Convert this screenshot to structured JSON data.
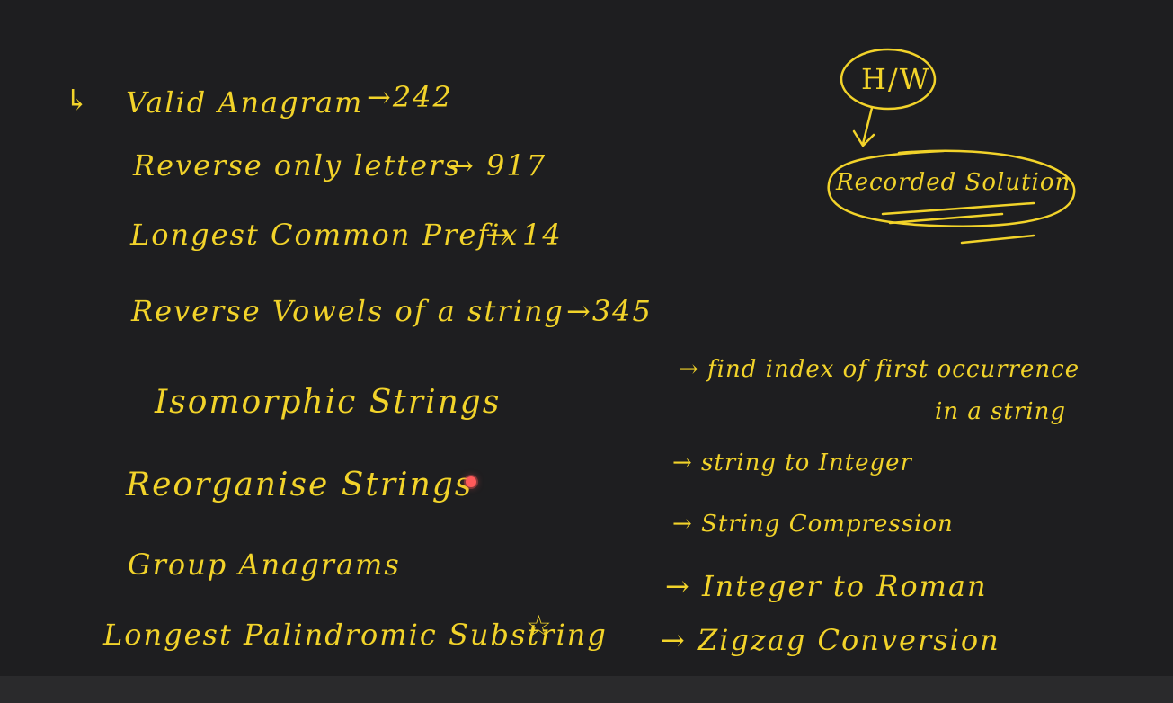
{
  "ink_color": "#f2d32a",
  "background": "#1e1e20",
  "left_list": {
    "items": [
      {
        "marker": "↳",
        "text": "Valid Anagram",
        "suffix": "→242"
      },
      {
        "text": "Reverse only letters",
        "suffix": "→ 917"
      },
      {
        "text": "Longest Common Prefix",
        "suffix": "→ 14"
      },
      {
        "text": "Reverse Vowels of a string",
        "suffix": "→345"
      },
      {
        "text": "Isomorphic Strings"
      },
      {
        "text": "Reorganise Strings"
      },
      {
        "text": "Group Anagrams"
      },
      {
        "text": "Longest Palindromic Substring",
        "suffix": "☆"
      }
    ]
  },
  "right_list": {
    "items": [
      {
        "text": "→ find index of  first occurrence"
      },
      {
        "text": "in a string"
      },
      {
        "text": "→  string to Integer"
      },
      {
        "text": "→  String Compression"
      },
      {
        "text": "→  Integer to Roman"
      },
      {
        "text": "→ Zigzag Conversion"
      }
    ]
  },
  "homework": {
    "label": "H/W",
    "box_label": "Recorded Solution"
  },
  "pointer": {
    "color": "#ff5a5a"
  }
}
